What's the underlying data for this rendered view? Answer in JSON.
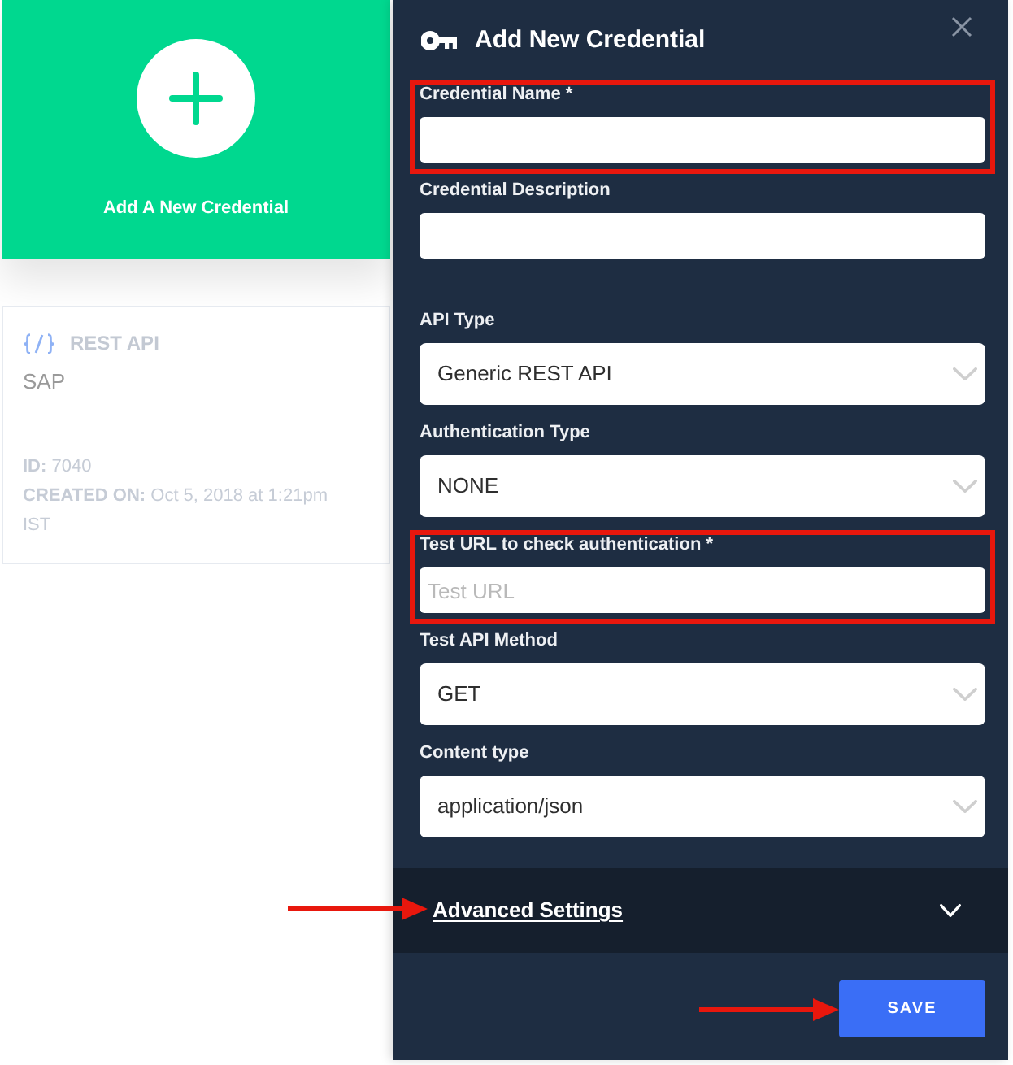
{
  "new_credential_card": {
    "label": "Add A New Credential"
  },
  "credentials": [
    {
      "type": "REST API",
      "name": "SAP",
      "id": "**ID:** 7040",
      "created": "**CREATED ON:** Oct 5, 2018 at 1:21pm IST"
    }
  ],
  "dialog": {
    "title": "Add New Credential",
    "sections": [
      {
        "fields": [
          {
            "kind": "input",
            "label": "Credential Name *",
            "highlighted": true
          },
          {
            "kind": "input",
            "label": "Credential Description",
            "highlighted": false
          }
        ]
      },
      {
        "fields": [
          {
            "kind": "select",
            "label": "API Type",
            "value": "Generic REST API",
            "highlighted": false
          },
          {
            "kind": "select",
            "label": "Authentication Type",
            "value": "NONE",
            "highlighted": false
          },
          {
            "kind": "input",
            "label": "Test URL to check authentication *",
            "placeholder": "Test URL",
            "highlighted": true
          },
          {
            "kind": "select",
            "label": "Test API Method",
            "value": "GET",
            "highlighted": false
          },
          {
            "kind": "select",
            "label": "Content type",
            "value": "application/json",
            "highlighted": false
          }
        ]
      }
    ],
    "advanced_settings": {
      "label": "Advanced Settings",
      "expanded": false,
      "arrow": true
    },
    "save_button": {
      "label": "SAVE",
      "arrow": true
    }
  }
}
